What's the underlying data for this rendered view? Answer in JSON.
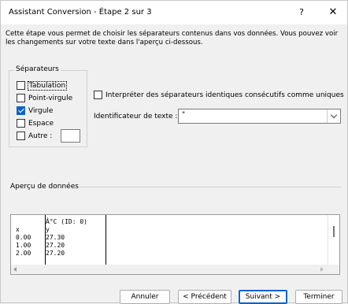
{
  "window": {
    "title": "Assistant Conversion - Étape 2 sur 3",
    "help_glyph": "?",
    "close_glyph": "✕"
  },
  "intro": "Cette étape vous permet de choisir les séparateurs contenus dans vos données. Vous pouvez voir les changements sur votre texte dans l'aperçu ci-dessous.",
  "separators": {
    "group_label": "Séparateurs",
    "items": [
      {
        "label": "Tabulation",
        "checked": false
      },
      {
        "label": "Point-virgule",
        "checked": false
      },
      {
        "label": "Virgule",
        "checked": true
      },
      {
        "label": "Espace",
        "checked": false
      },
      {
        "label": "Autre :",
        "checked": false
      }
    ],
    "other_value": ""
  },
  "consecutive": {
    "label": "Interpréter des séparateurs identiques consécutifs comme uniques",
    "checked": false
  },
  "text_qualifier": {
    "label": "Identificateur de texte :",
    "value": "\""
  },
  "preview": {
    "label": "Aperçu de données",
    "columns": [
      {
        "cells": [
          "",
          "x",
          "0.00",
          "1.00",
          "2.00"
        ]
      },
      {
        "cells": [
          "Â°C (ID: 0)",
          "y",
          "27.30",
          "27.20",
          "27.20"
        ]
      }
    ]
  },
  "buttons": {
    "cancel": "Annuler",
    "previous": "< Précédent",
    "next": "Suivant >",
    "finish": "Terminer"
  },
  "colors": {
    "accent": "#0a64c8",
    "background": "#f0f0f0"
  }
}
